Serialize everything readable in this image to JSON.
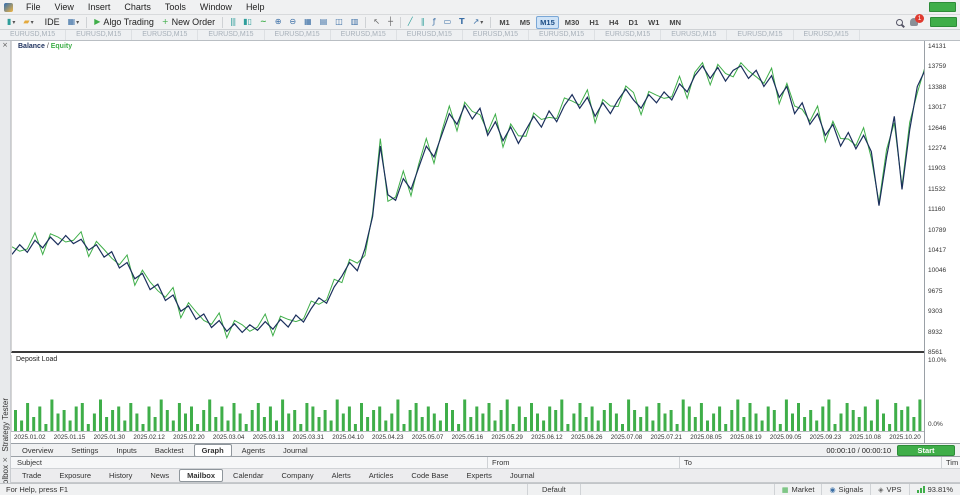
{
  "menu": {
    "items": [
      "File",
      "View",
      "Insert",
      "Charts",
      "Tools",
      "Window",
      "Help"
    ]
  },
  "toolbar": {
    "ide_label": "IDE",
    "algo_trading_label": "Algo Trading",
    "new_order_label": "New Order",
    "timeframes": [
      "M1",
      "M5",
      "M15",
      "M30",
      "H1",
      "H4",
      "D1",
      "W1",
      "MN"
    ],
    "active_timeframe": "M15",
    "badge_count": "1"
  },
  "icons": {
    "caret": "▾",
    "candle": "▮",
    "folder": "▰",
    "grid": "▦",
    "grid2": "▤",
    "grid3": "◫",
    "grid4": "▥",
    "play": "▶",
    "plus": "+",
    "bars_chart": "|||",
    "candles_chart": "▮▯",
    "line_chart": "~",
    "zoom_in": "⊕",
    "zoom_out": "⊖",
    "cursor": "↖",
    "crosshair": "┼",
    "trendline": "╱",
    "channel": "∥",
    "fibonacci": "ƒ",
    "shapes": "▭",
    "text_tool": "T",
    "arrow_tool": "↗",
    "close": "×",
    "market": "▦",
    "signals": "◉",
    "vps": "◈"
  },
  "chart_tabs": {
    "labels": [
      "EURUSD,M15",
      "EURUSD,M15",
      "EURUSD,M15",
      "EURUSD,M15",
      "EURUSD,M15",
      "EURUSD,M15",
      "EURUSD,M15",
      "EURUSD,M15",
      "EURUSD,M15",
      "EURUSD,M15",
      "EURUSD,M15",
      "EURUSD,M15",
      "EURUSD,M15"
    ]
  },
  "tester": {
    "panel_title": "Strategy Tester",
    "legend_balance": "Balance",
    "legend_separator": "/",
    "legend_equity": "Equity",
    "deposit_load_label": "Deposit Load",
    "y_axis": [
      "14131",
      "13759",
      "13388",
      "13017",
      "12646",
      "12274",
      "11903",
      "11532",
      "11160",
      "10789",
      "10417",
      "10046",
      "9675",
      "9303",
      "8932",
      "8561"
    ],
    "load_axis": [
      "10.0%",
      "0.0%"
    ],
    "x_axis": [
      "2025.01.02",
      "2025.01.15",
      "2025.01.30",
      "2025.02.12",
      "2025.02.20",
      "2025.03.04",
      "2025.03.13",
      "2025.03.31",
      "2025.04.10",
      "2025.04.23",
      "2025.05.07",
      "2025.05.16",
      "2025.05.29",
      "2025.06.12",
      "2025.06.26",
      "2025.07.08",
      "2025.07.21",
      "2025.08.05",
      "2025.08.19",
      "2025.09.05",
      "2025.09.23",
      "2025.10.08",
      "2025.10.20"
    ],
    "tabs": [
      "Overview",
      "Settings",
      "Inputs",
      "Backtest",
      "Graph",
      "Agents",
      "Journal"
    ],
    "active_tab": "Graph",
    "progress_time": "00:00:10 / 00:00:10",
    "start_label": "Start"
  },
  "mailbox": {
    "columns": [
      "Subject",
      "From",
      "To",
      "Tim"
    ]
  },
  "toolbox": {
    "panel_title": "Toolbox",
    "tabs": [
      "Trade",
      "Exposure",
      "History",
      "News",
      "Mailbox",
      "Calendar",
      "Company",
      "Alerts",
      "Articles",
      "Code Base",
      "Experts",
      "Journal"
    ],
    "active_tab": "Mailbox"
  },
  "status_bar": {
    "help": "For Help, press F1",
    "profile": "Default",
    "market": "Market",
    "signals": "Signals",
    "vps": "VPS",
    "connection": "93.81%"
  },
  "chart_data": {
    "type": "line",
    "title": "Balance / Equity",
    "x_start": "2025.01.02",
    "x_end": "2025.10.20",
    "ylim": [
      8480,
      14240
    ],
    "y_ticks": [
      14131,
      13759,
      13388,
      13017,
      12646,
      12274,
      11903,
      11532,
      11160,
      10789,
      10417,
      10046,
      9675,
      9303,
      8932,
      8561
    ],
    "grid": false,
    "legend_position": "top-left",
    "series": [
      {
        "name": "Balance",
        "color": "#1b2f5c",
        "values": [
          10300,
          10480,
          10340,
          10560,
          10420,
          10620,
          10480,
          10650,
          10500,
          10580,
          10380,
          10480,
          10250,
          10350,
          10050,
          10150,
          9850,
          9950,
          9650,
          9750,
          9450,
          9550,
          9250,
          9350,
          9100,
          9200,
          8950,
          9080,
          8880,
          9020,
          8860,
          9000,
          8900,
          9060,
          8920,
          9100,
          8960,
          9180,
          9050,
          9300,
          9500,
          9400,
          9700,
          9900,
          10150,
          10000,
          10400,
          11000,
          12300,
          11400,
          11300,
          11700,
          11500,
          11900,
          12300,
          12100,
          12500,
          12900,
          12700,
          13050,
          12800,
          13000,
          12500,
          12750,
          12400,
          12650,
          12350,
          12600,
          12850,
          12650,
          12950,
          12750,
          13050,
          13250,
          13000,
          13200,
          12850,
          13100,
          12900,
          13150,
          13350,
          13150,
          13000,
          13250,
          13100,
          13300,
          13150,
          13450,
          13300,
          13600,
          13780,
          13550,
          13750,
          13500,
          13700,
          13780,
          13550,
          13700,
          13400,
          13600,
          13200,
          13400,
          12900,
          13100,
          12700,
          12900,
          12500,
          12700,
          12300,
          12550,
          12250,
          12500,
          12200,
          11200,
          12100,
          12850,
          11500,
          12600,
          13400,
          13700
        ]
      },
      {
        "name": "Equity",
        "color": "#3fae49",
        "values": [
          10440,
          10360,
          10400,
          10700,
          10300,
          10680,
          10620,
          10530,
          10560,
          10720,
          10260,
          10540,
          10390,
          10230,
          10110,
          10290,
          9730,
          10010,
          9790,
          9630,
          9510,
          9690,
          9130,
          9410,
          9240,
          9080,
          9010,
          9220,
          8760,
          9080,
          9000,
          8880,
          8960,
          9200,
          8800,
          9160,
          9100,
          9060,
          9110,
          9440,
          9380,
          9460,
          9840,
          9780,
          10210,
          10140,
          10280,
          11060,
          12440,
          11280,
          11360,
          11840,
          11380,
          11960,
          12440,
          11980,
          12560,
          13040,
          12580,
          13110,
          12940,
          12880,
          12560,
          12890,
          12280,
          12710,
          12490,
          12480,
          12910,
          12790,
          12830,
          12810,
          13190,
          13130,
          13060,
          13340,
          12730,
          13160,
          13040,
          13030,
          13410,
          13290,
          12880,
          13310,
          13240,
          13180,
          13210,
          13590,
          13180,
          13660,
          13840,
          13430,
          13810,
          13640,
          13580,
          13840,
          13690,
          13580,
          13460,
          13740,
          13080,
          13460,
          13040,
          12980,
          12760,
          13040,
          12380,
          12760,
          12440,
          12430,
          12310,
          12640,
          12080,
          11260,
          12240,
          12730,
          11560,
          12740,
          13280,
          13760
        ]
      }
    ],
    "deposit_load": {
      "type": "bar",
      "ylabel": "Deposit Load",
      "ylim": [
        0,
        10
      ],
      "ticks": [
        "10.0%",
        "0.0%"
      ],
      "color": "#3fae49",
      "values": [
        3,
        1.5,
        4,
        2,
        3.5,
        1,
        4.5,
        2.5,
        3,
        1.5,
        3.5,
        4,
        1,
        2.5,
        4.5,
        2,
        3,
        3.5,
        1.5,
        4,
        2.5,
        1,
        3.5,
        2,
        4.5,
        3,
        1.5,
        4,
        2.5,
        3.5,
        1,
        3,
        4.5,
        2,
        3.5,
        1.5,
        4,
        2.5,
        1,
        3,
        4,
        2,
        3.5,
        1.5,
        4.5,
        2.5,
        3,
        1,
        4,
        3.5,
        2,
        3,
        1.5,
        4.5,
        2.5,
        3.5,
        1,
        4,
        2,
        3,
        3.5,
        1.5,
        2.5,
        4.5,
        1,
        3,
        4,
        2,
        3.5,
        2.5,
        1.5,
        4,
        3,
        1,
        4.5,
        2,
        3.5,
        2.5,
        4,
        1.5,
        3,
        4.5,
        1,
        3.5,
        2,
        4,
        2.5,
        1.5,
        3.5,
        3,
        4.5,
        1,
        2.5,
        4,
        2,
        3.5,
        1.5,
        3,
        4,
        2.5,
        1,
        4.5,
        3,
        2,
        3.5,
        1.5,
        4,
        2.5,
        3,
        1,
        4.5,
        3.5,
        2,
        4,
        1.5,
        2.5,
        3.5,
        1,
        3,
        4.5,
        2,
        4,
        2.5,
        1.5,
        3.5,
        3,
        1,
        4.5,
        2.5,
        4,
        2,
        3,
        1.5,
        3.5,
        4.5,
        1,
        2.5,
        4,
        3,
        2,
        3.5,
        1.5,
        4.5,
        2.5,
        1,
        4,
        3,
        3.5,
        2,
        4.5
      ]
    }
  }
}
